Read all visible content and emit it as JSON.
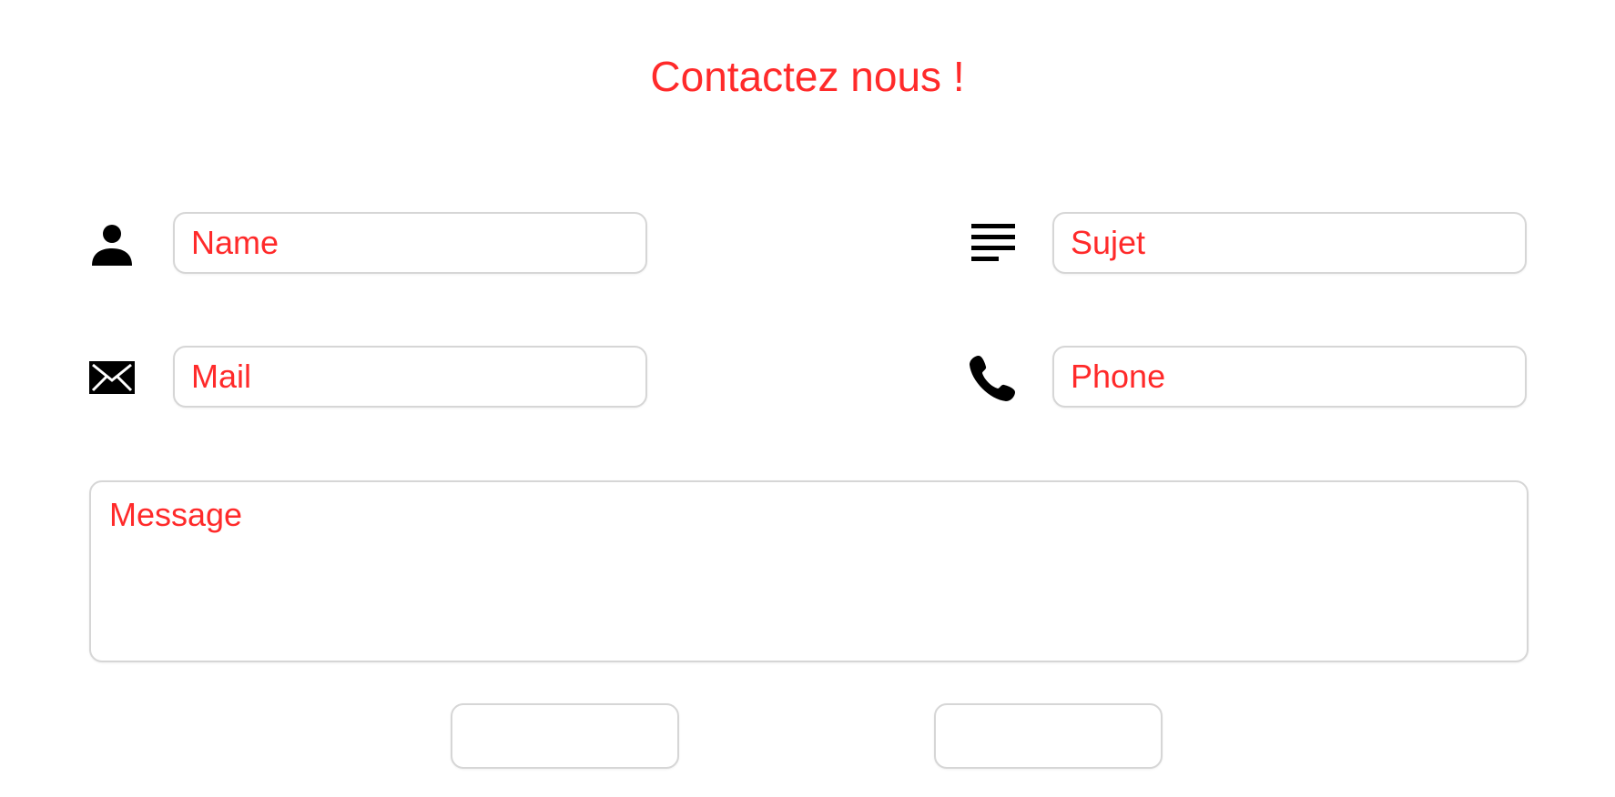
{
  "page": {
    "title": "Contactez nous !",
    "accent_color": "#ff2a2a"
  },
  "form": {
    "name": {
      "placeholder": "Name",
      "icon": "person-icon"
    },
    "subject": {
      "placeholder": "Sujet",
      "icon": "subject-lines-icon"
    },
    "mail": {
      "placeholder": "Mail",
      "icon": "envelope-icon"
    },
    "phone": {
      "placeholder": "Phone",
      "icon": "phone-icon"
    },
    "message": {
      "placeholder": "Message"
    },
    "buttons": {
      "left_label": "",
      "right_label": ""
    }
  }
}
